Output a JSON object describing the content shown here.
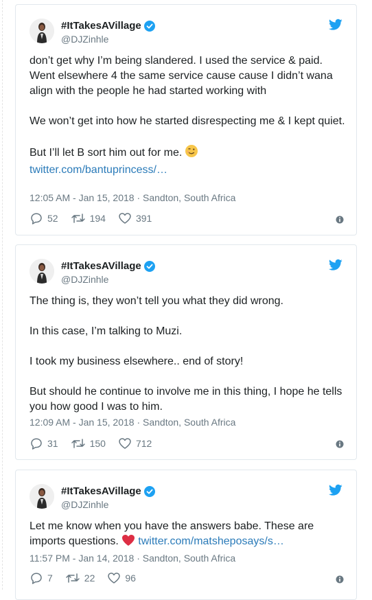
{
  "tweets": [
    {
      "display_name": "#ItTakesAVillage",
      "handle": "@DJZinhle",
      "paragraphs": [
        "don’t get why I’m being slandered. I used the service & paid. Went elsewhere 4 the same service cause cause I didn’t wana align with the people he had started working with",
        "We won’t get into how he started disrespecting me & I kept quiet.",
        "But I’ll let B sort him out for me."
      ],
      "emoji": "winking-face",
      "link": "twitter.com/bantuprincess/…",
      "timestamp": "12:05 AM - Jan 15, 2018",
      "location": "Sandton, South Africa",
      "replies": "52",
      "retweets": "194",
      "likes": "391"
    },
    {
      "display_name": "#ItTakesAVillage",
      "handle": "@DJZinhle",
      "paragraphs": [
        "The thing is, they won’t tell you what they did wrong.",
        "In this case, I’m talking to Muzi.",
        "I took my business elsewhere.. end of story!",
        "But should he continue to involve me in this thing, I hope he tells you how good I was to him."
      ],
      "timestamp": "12:09 AM - Jan 15, 2018",
      "location": "Sandton, South Africa",
      "replies": "31",
      "retweets": "150",
      "likes": "712"
    },
    {
      "display_name": "#ItTakesAVillage",
      "handle": "@DJZinhle",
      "paragraphs": [
        "Let me know when you have the answers babe. These are imports questions."
      ],
      "emoji": "red-heart",
      "link": "twitter.com/matsheposays/s…",
      "timestamp": "11:57 PM - Jan 14, 2018",
      "location": "Sandton, South Africa",
      "replies": "7",
      "retweets": "22",
      "likes": "96"
    }
  ],
  "colors": {
    "twitter_blue": "#1da1f2",
    "link": "#2b7bb9",
    "meta_gray": "#697882",
    "border": "#e1e8ed",
    "heart": "#e0245e"
  },
  "meta_separator": "·"
}
